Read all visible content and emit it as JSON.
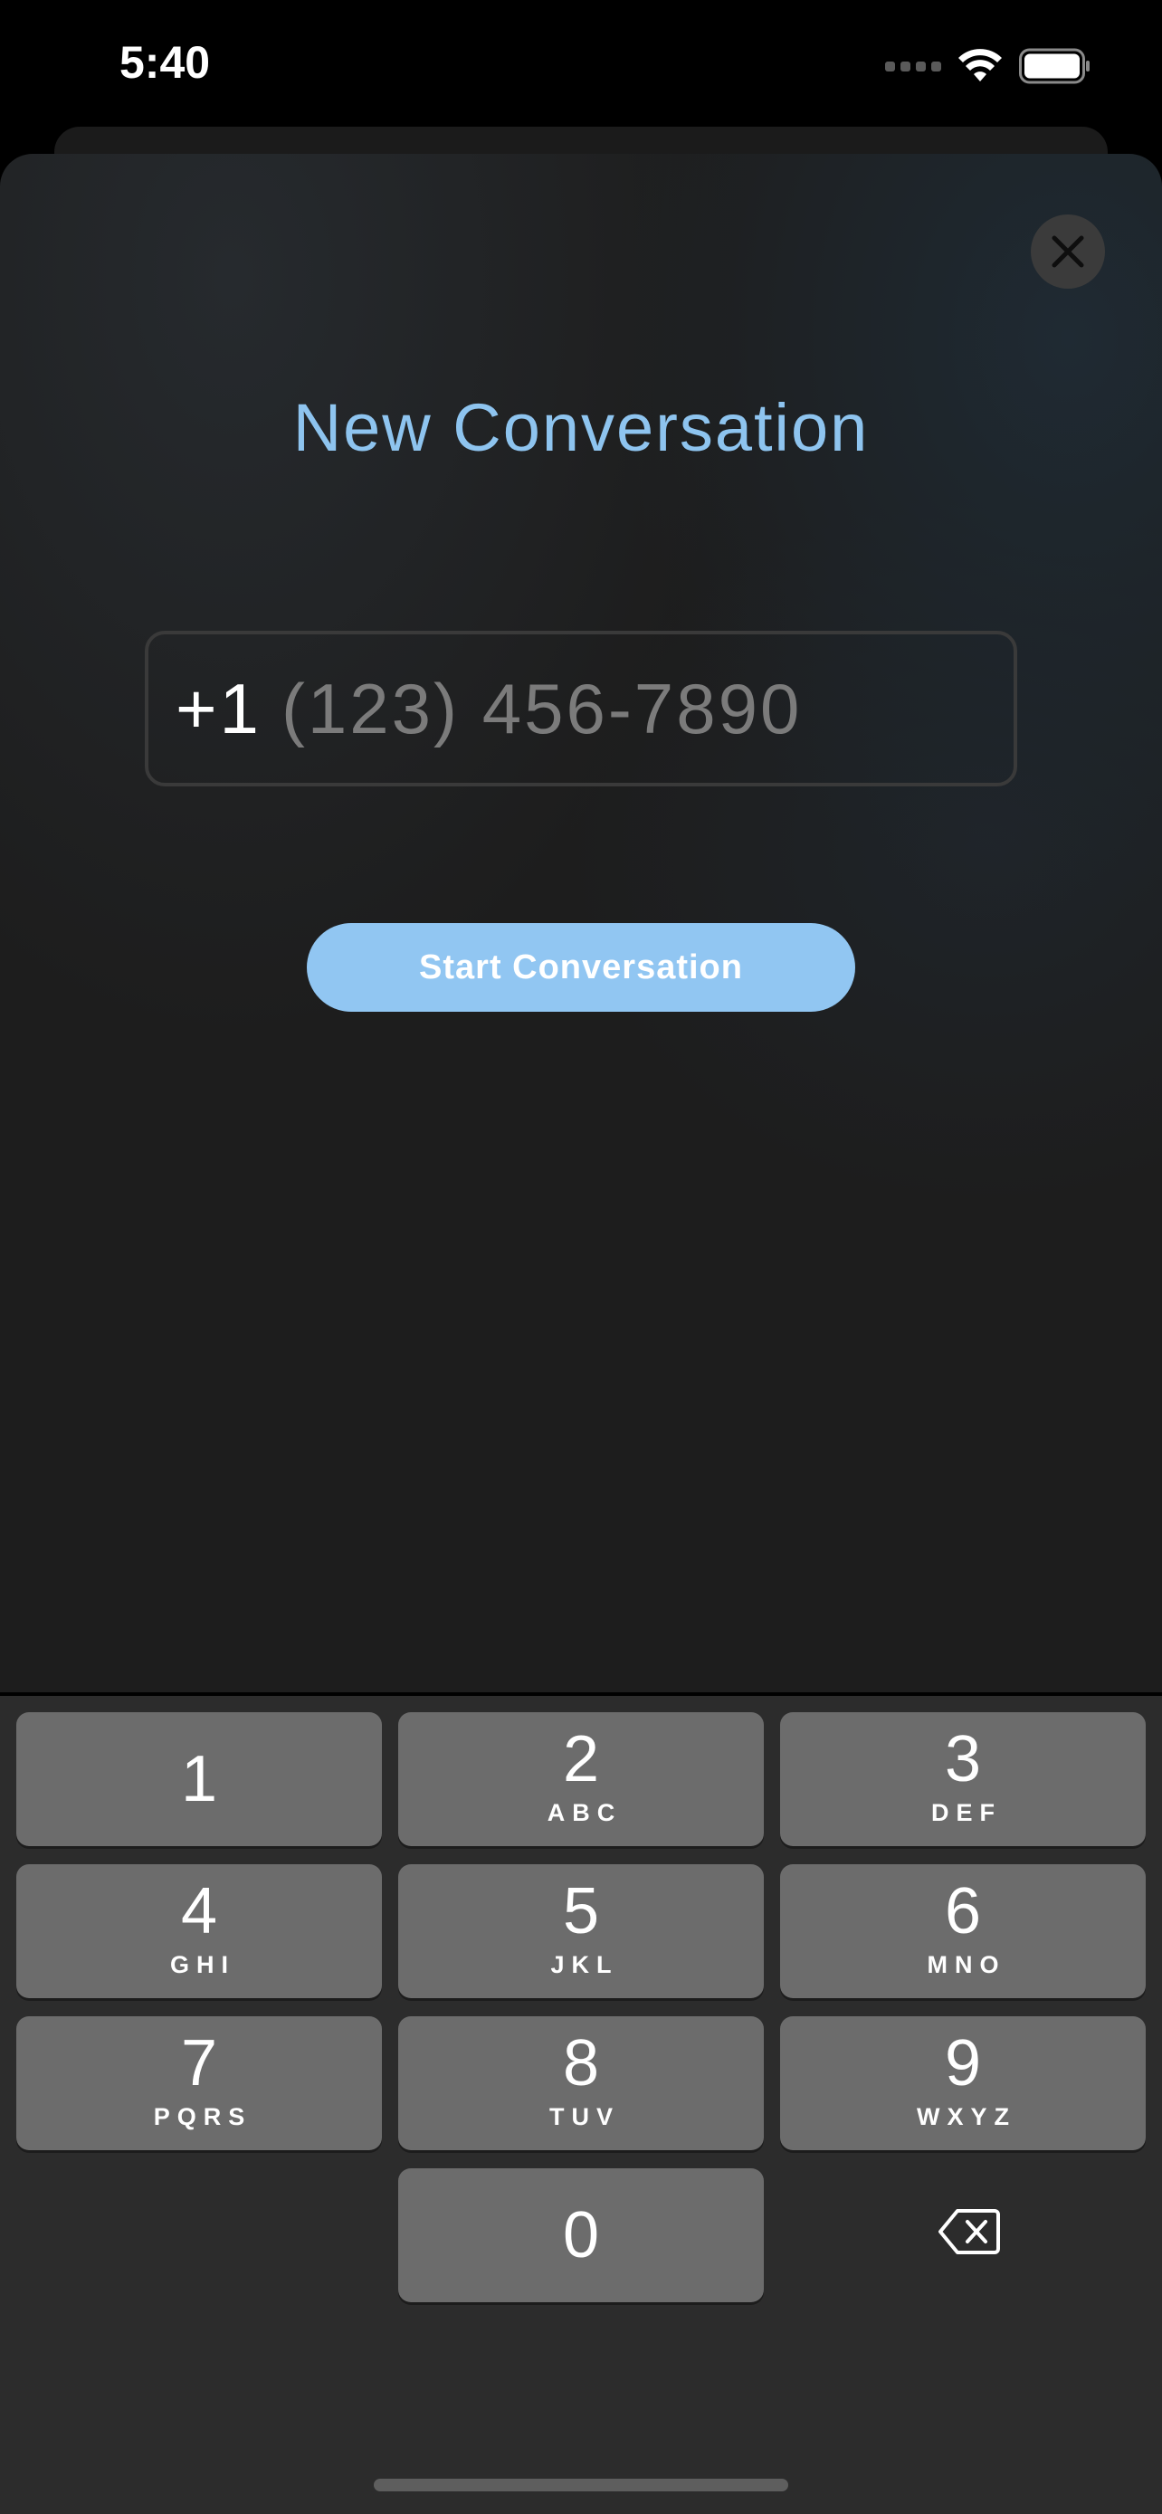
{
  "status_bar": {
    "time": "5:40"
  },
  "sheet": {
    "title": "New Conversation",
    "phone": {
      "prefix": "+1",
      "placeholder": "(123) 456-7890",
      "value": ""
    },
    "start_button_label": "Start Conversation"
  },
  "keypad": {
    "keys": [
      {
        "digit": "1",
        "letters": ""
      },
      {
        "digit": "2",
        "letters": "ABC"
      },
      {
        "digit": "3",
        "letters": "DEF"
      },
      {
        "digit": "4",
        "letters": "GHI"
      },
      {
        "digit": "5",
        "letters": "JKL"
      },
      {
        "digit": "6",
        "letters": "MNO"
      },
      {
        "digit": "7",
        "letters": "PQRS"
      },
      {
        "digit": "8",
        "letters": "TUV"
      },
      {
        "digit": "9",
        "letters": "WXYZ"
      },
      {
        "digit": "0",
        "letters": ""
      }
    ]
  },
  "icons": {
    "close": "close-icon",
    "backspace": "backspace-icon",
    "wifi": "wifi-icon",
    "battery": "battery-icon",
    "signal": "signal-icon"
  },
  "colors": {
    "accent": "#91c6f2",
    "title": "#8ec4ef",
    "key": "#6c6c6c",
    "keypad_bg": "#2c2c2c",
    "sheet_bg": "#1d1d1d"
  }
}
